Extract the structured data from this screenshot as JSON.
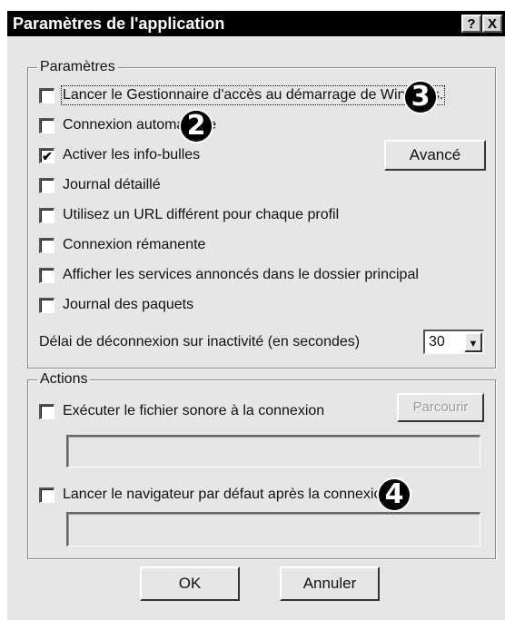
{
  "window": {
    "title": "Paramètres de l'application",
    "help_label": "?",
    "close_label": "X"
  },
  "settings_group": {
    "legend": "Paramètres",
    "options": [
      {
        "label": "Lancer le Gestionnaire d'accès au démarrage de Windows.",
        "checked": false
      },
      {
        "label": "Connexion automatique",
        "checked": false
      },
      {
        "label": "Activer les info-bulles",
        "checked": true
      },
      {
        "label": "Journal détaillé",
        "checked": false
      },
      {
        "label": "Utilisez un URL différent pour chaque profil",
        "checked": false
      },
      {
        "label": "Connexion rémanente",
        "checked": false
      },
      {
        "label": "Afficher les services annoncés dans le dossier principal",
        "checked": false
      },
      {
        "label": "Journal des paquets",
        "checked": false
      }
    ],
    "advanced_button": "Avancé",
    "timeout_label": "Délai de déconnexion sur inactivité (en secondes)",
    "timeout_value": "30"
  },
  "actions_group": {
    "legend": "Actions",
    "sound_label": "Exécuter le fichier sonore à la connexion",
    "sound_checked": false,
    "sound_path": "",
    "browse_button": "Parcourir",
    "browser_label": "Lancer le navigateur par défaut après la connexion",
    "browser_checked": false,
    "browser_url": ""
  },
  "footer": {
    "ok_button": "OK",
    "cancel_button": "Annuler"
  },
  "callouts": {
    "badge_2": "2",
    "badge_3": "3",
    "badge_4": "4"
  }
}
